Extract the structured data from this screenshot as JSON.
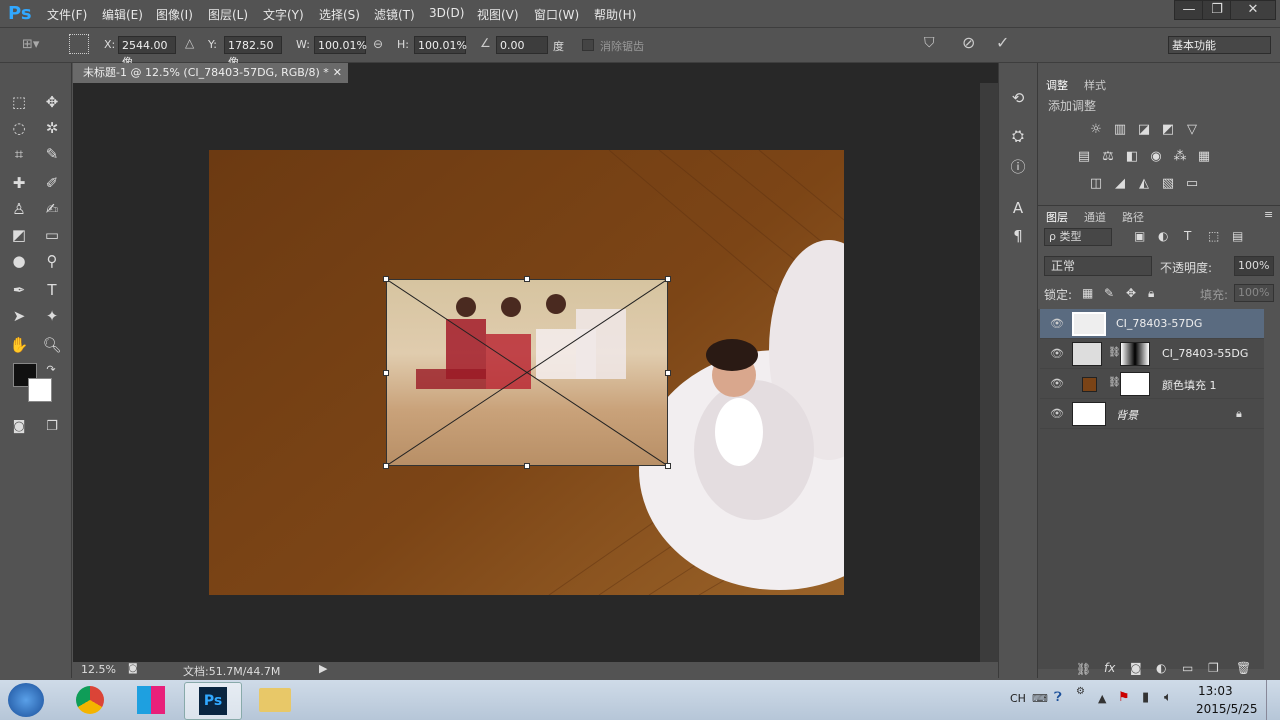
{
  "app": {
    "logo": "Ps"
  },
  "menu": [
    "文件(F)",
    "编辑(E)",
    "图像(I)",
    "图层(L)",
    "文字(Y)",
    "选择(S)",
    "滤镜(T)",
    "3D(D)",
    "视图(V)",
    "窗口(W)",
    "帮助(H)"
  ],
  "window_controls": {
    "minimize": "—",
    "restore": "❐",
    "close": "✕"
  },
  "options": {
    "x_label": "X:",
    "x_value": "2544.00 像",
    "y_label": "Y:",
    "y_value": "1782.50 像",
    "w_label": "W:",
    "w_value": "100.01%",
    "h_label": "H:",
    "h_value": "100.01%",
    "angle_value": "0.00",
    "angle_unit": "度",
    "antialias_label": "消除锯齿",
    "workspace": "基本功能"
  },
  "document": {
    "tab_title": "未标题-1 @ 12.5% (CI_78403-57DG, RGB/8) *",
    "zoom": "12.5%",
    "doc_info": "文档:51.7M/44.7M"
  },
  "panels": {
    "adjust_tab": "调整",
    "style_tab": "样式",
    "add_adjustment": "添加调整",
    "layers_tab": "图层",
    "channels_tab": "通道",
    "paths_tab": "路径",
    "filter_kind": "ρ 类型",
    "blend_mode": "正常",
    "opacity_label": "不透明度:",
    "opacity_value": "100%",
    "lock_label": "锁定:",
    "fill_label": "填充:",
    "fill_value": "100%"
  },
  "layers": [
    {
      "name": "CI_78403-57DG",
      "selected": true
    },
    {
      "name": "CI_78403-55DG",
      "selected": false
    },
    {
      "name": "颜色填充 1",
      "selected": false
    },
    {
      "name": "背景",
      "selected": false,
      "locked": true
    }
  ],
  "taskbar": {
    "lang": "CH",
    "time": "13:03",
    "date": "2015/5/25"
  },
  "colors": {
    "accent": "#31a8ff",
    "canvas_brown": "#7a4316",
    "selected_layer": "#5a6b80"
  }
}
